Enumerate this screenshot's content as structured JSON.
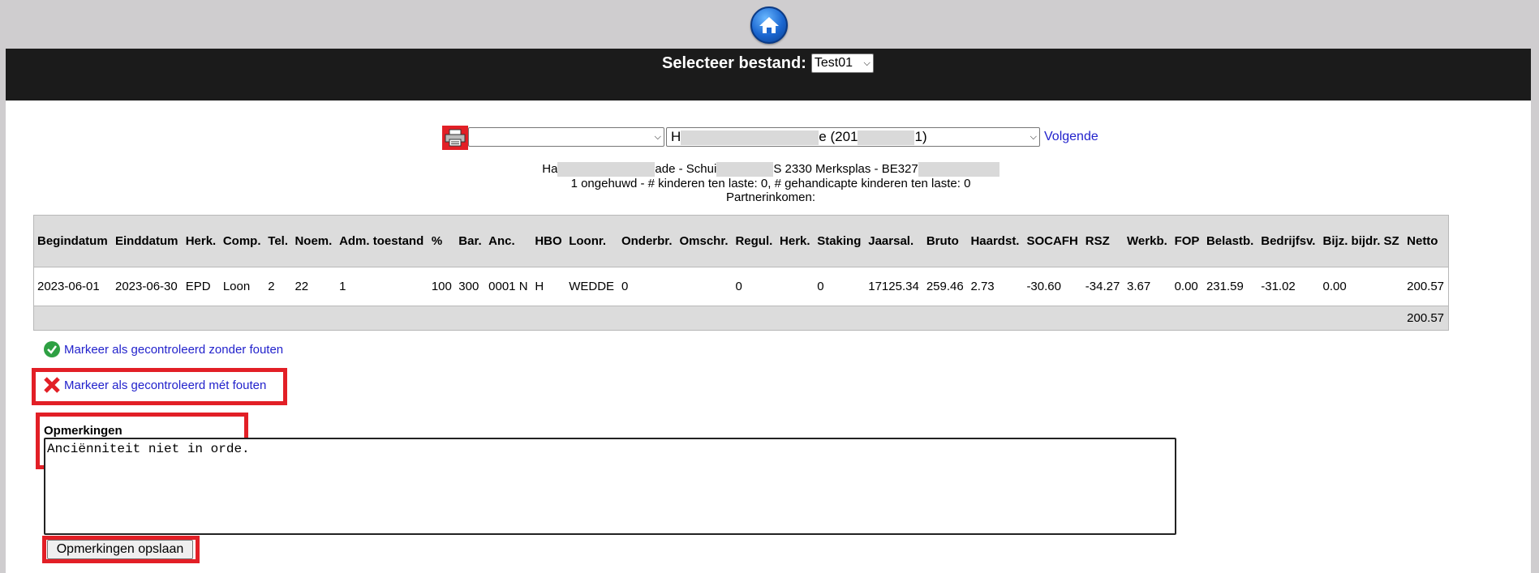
{
  "header": {
    "title_label": "Selecteer bestand:",
    "file_select": "Test01"
  },
  "icons": {
    "home": "home-icon",
    "printer": "printer-icon",
    "check": "check-circle-icon",
    "cross": "red-x-icon"
  },
  "selectors": {
    "first_select": "",
    "second_select_prefix": "H",
    "second_select_mid": "e (201",
    "second_select_suffix": "1)",
    "next_link": "Volgende"
  },
  "employee": {
    "address_prefix": "Ha",
    "address_mid1": "ade - Schui",
    "address_mid2": "S 2330 Merksplas - BE327",
    "family_line": "1 ongehuwd - # kinderen ten laste: 0, # gehandicapte kinderen ten laste: 0",
    "partner_line": "Partnerinkomen:"
  },
  "table": {
    "headers": [
      "Begindatum",
      "Einddatum",
      "Herk.",
      "Comp.",
      "Tel.",
      "Noem.",
      "Adm. toestand",
      "%",
      "Bar.",
      "Anc.",
      "HBO",
      "Loonr.",
      "Onderbr.",
      "Omschr.",
      "Regul.",
      "Herk.",
      "Staking",
      "Jaarsal.",
      "Bruto",
      "Haardst.",
      "SOCAFH",
      "RSZ",
      "Werkb.",
      "FOP",
      "Belastb.",
      "Bedrijfsv.",
      "Bijz. bijdr. SZ",
      "Netto"
    ],
    "row": [
      "2023-06-01",
      "2023-06-30",
      "EPD",
      "Loon",
      "2",
      "22",
      "1",
      "100",
      "300",
      "0001 N",
      "H",
      "WEDDE",
      "0",
      "",
      "0",
      "",
      "0",
      "17125.34",
      "259.46",
      "2.73",
      "-30.60",
      "-34.27",
      "3.67",
      "0.00",
      "231.59",
      "-31.02",
      "0.00",
      "200.57"
    ],
    "total_netto": "200.57"
  },
  "actions": {
    "mark_ok": "Markeer als gecontroleerd zonder fouten",
    "mark_errors": "Markeer als gecontroleerd mét fouten"
  },
  "remarks": {
    "label": "Opmerkingen",
    "value": "Anciënniteit niet in orde.",
    "save_button": "Opmerkingen opslaan"
  },
  "colors": {
    "header_bg": "#1b1b1b",
    "page_bg": "#cfcdcf",
    "highlight_red": "#e21f26",
    "link_blue": "#2222cc"
  }
}
